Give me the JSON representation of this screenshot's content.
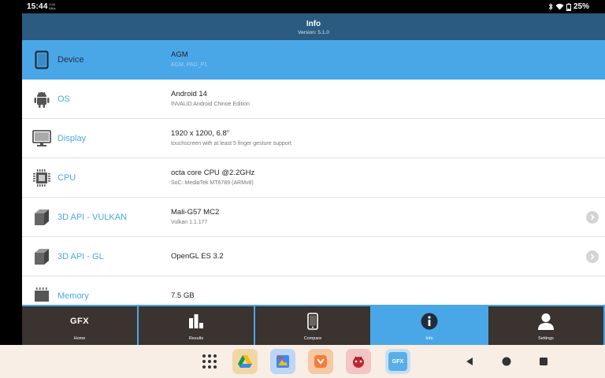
{
  "status_bar": {
    "time": "15:44",
    "net_speed_value": "0.00",
    "net_speed_unit": "KB/s",
    "battery": "25%"
  },
  "header": {
    "title": "Info",
    "version": "Version: 5.1.0"
  },
  "rows": [
    {
      "label": "Device",
      "value": "AGM",
      "sub": "AGM, PAD_P1",
      "icon": "tablet-icon",
      "chevron": false,
      "selected": true
    },
    {
      "label": "OS",
      "value": "Android 14",
      "sub": "INVALID Android Chinoe Edition",
      "icon": "android-icon",
      "chevron": false,
      "selected": false
    },
    {
      "label": "Display",
      "value": "1920 x 1200, 6.8\"",
      "sub": "touchscreen with at least 5 finger gesture support",
      "icon": "monitor-icon",
      "chevron": false,
      "selected": false
    },
    {
      "label": "CPU",
      "value": "octa core CPU @2.2GHz",
      "sub": "SoC: MediaTek MT6789 (ARMv8)",
      "icon": "cpu-chip-icon",
      "chevron": false,
      "selected": false
    },
    {
      "label": "3D API - VULKAN",
      "value": "Mali-G57 MC2",
      "sub": "Vulkan 1.1.177",
      "icon": "cube-icon",
      "chevron": true,
      "selected": false
    },
    {
      "label": "3D API - GL",
      "value": "OpenGL ES 3.2",
      "sub": "",
      "icon": "cube-icon",
      "chevron": true,
      "selected": false
    },
    {
      "label": "Memory",
      "value": "7.5 GB",
      "sub": "",
      "icon": "memory-icon",
      "chevron": false,
      "selected": false
    }
  ],
  "bottom_nav": {
    "home": {
      "label": "Home",
      "logo_text": "GFX"
    },
    "results": {
      "label": "Results"
    },
    "compare": {
      "label": "Compare"
    },
    "info": {
      "label": "Info"
    },
    "settings": {
      "label": "Settings"
    }
  },
  "taskbar": {
    "apps": [
      "drive-icon",
      "photos-icon",
      "swiftkey-icon",
      "app-red-icon",
      "gfxbench-icon"
    ],
    "gfx_app_text": "GFX"
  },
  "colors": {
    "header": "#2b5b80",
    "accent": "#4aa7e7",
    "nav_background": "#3a332f",
    "taskbar": "#f8eee6"
  }
}
